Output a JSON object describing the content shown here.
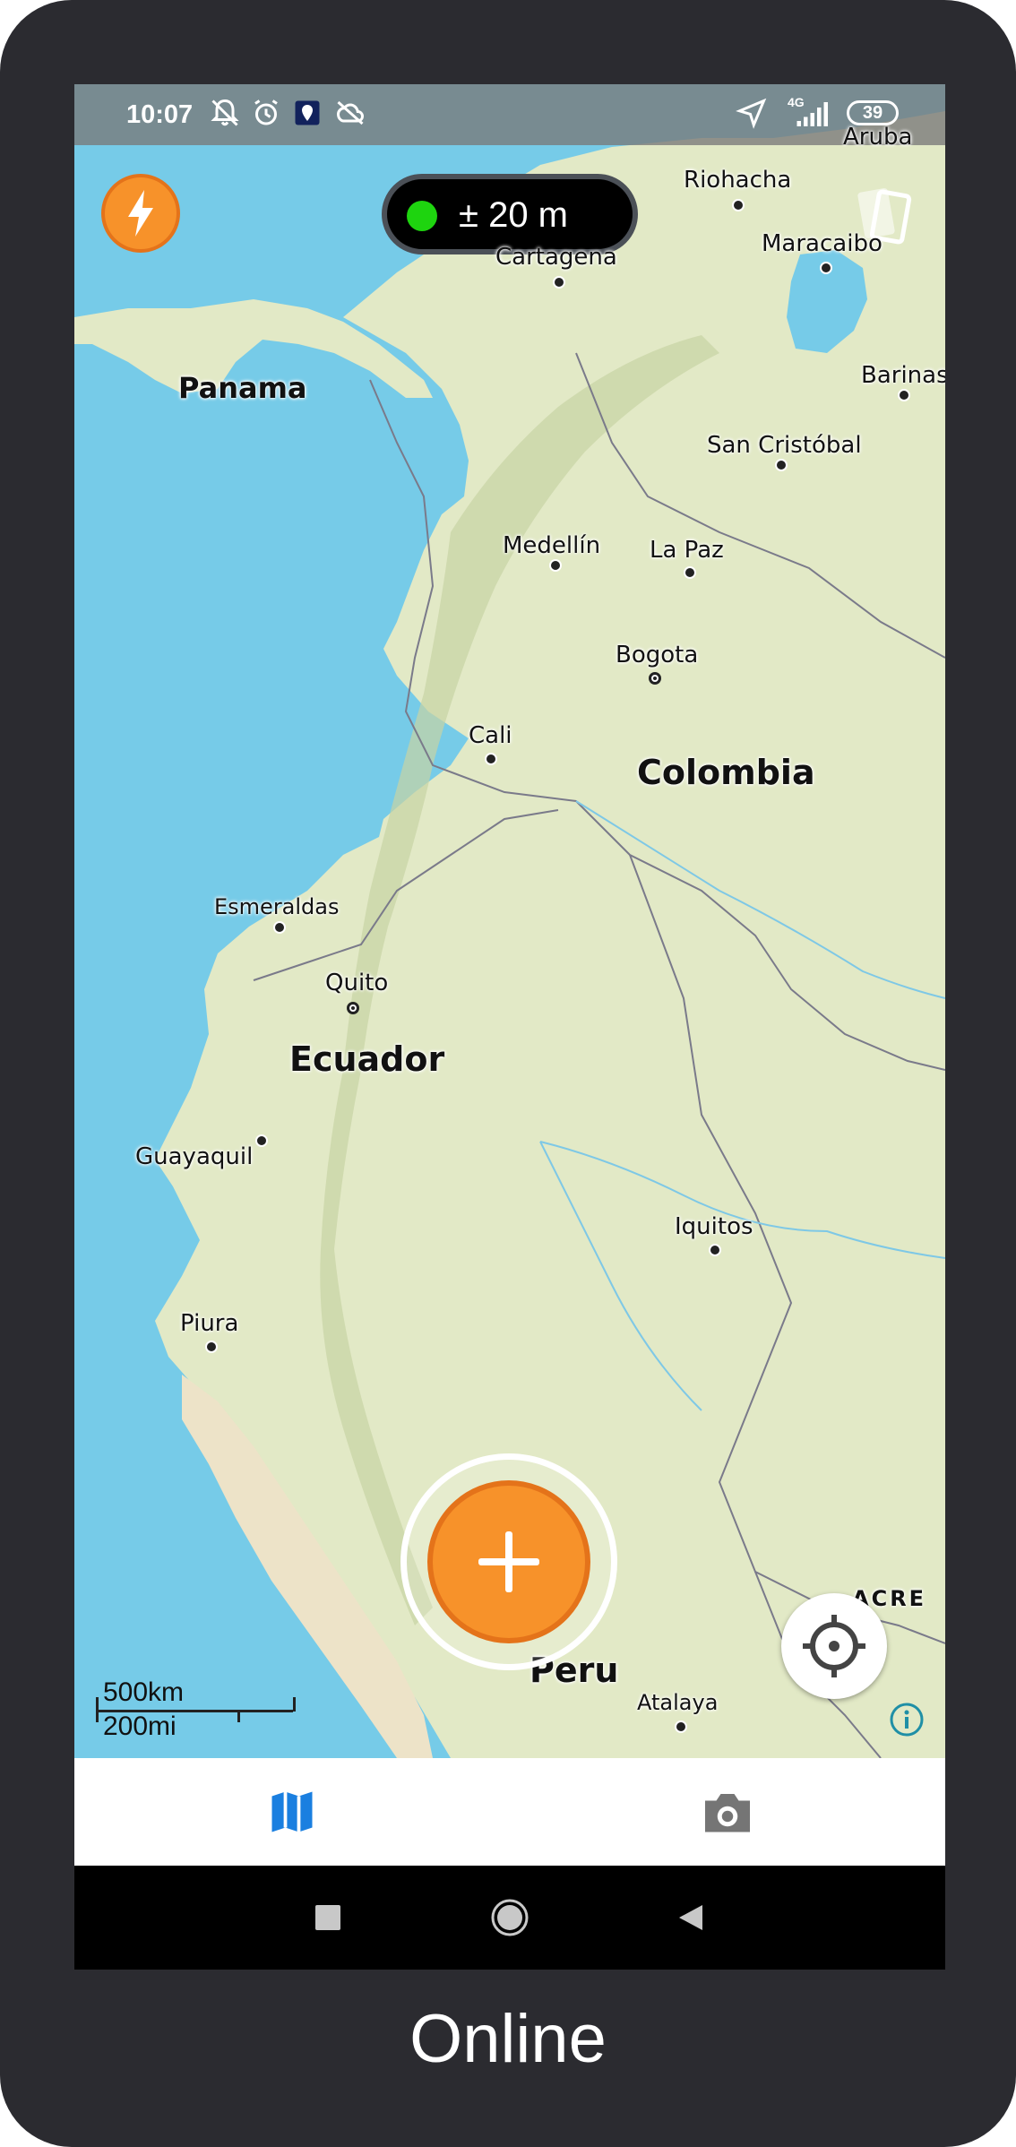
{
  "statusbar": {
    "time": "10:07",
    "network": "4G",
    "battery": "39",
    "icons": [
      "bell-off-icon",
      "alarm-icon",
      "location-pin-icon",
      "cloud-off-icon",
      "navigation-arrow-icon",
      "signal-icon",
      "battery-icon"
    ]
  },
  "map": {
    "accuracy_label": "± 20 m",
    "accuracy_status_color": "#1ed40f",
    "accent_color": "#f7922a",
    "countries": [
      "Panama",
      "Colombia",
      "Ecuador",
      "Peru"
    ],
    "region": "ACRE",
    "cities": [
      "Aruba",
      "Riohacha",
      "Cartagena",
      "Maracaibo",
      "Barinas",
      "San Cristóbal",
      "Medellín",
      "La Paz",
      "Bogota",
      "Cali",
      "Esmeraldas",
      "Quito",
      "Guayaquil",
      "Iquitos",
      "Piura",
      "Atalaya"
    ],
    "scale": {
      "metric": "500km",
      "imperial": "200mi"
    }
  },
  "tabs": [
    {
      "name": "map",
      "icon": "map-icon",
      "active": true,
      "color": "#1a7fe0"
    },
    {
      "name": "camera",
      "icon": "camera-icon",
      "active": false,
      "color": "#757575"
    }
  ],
  "caption": "Online"
}
